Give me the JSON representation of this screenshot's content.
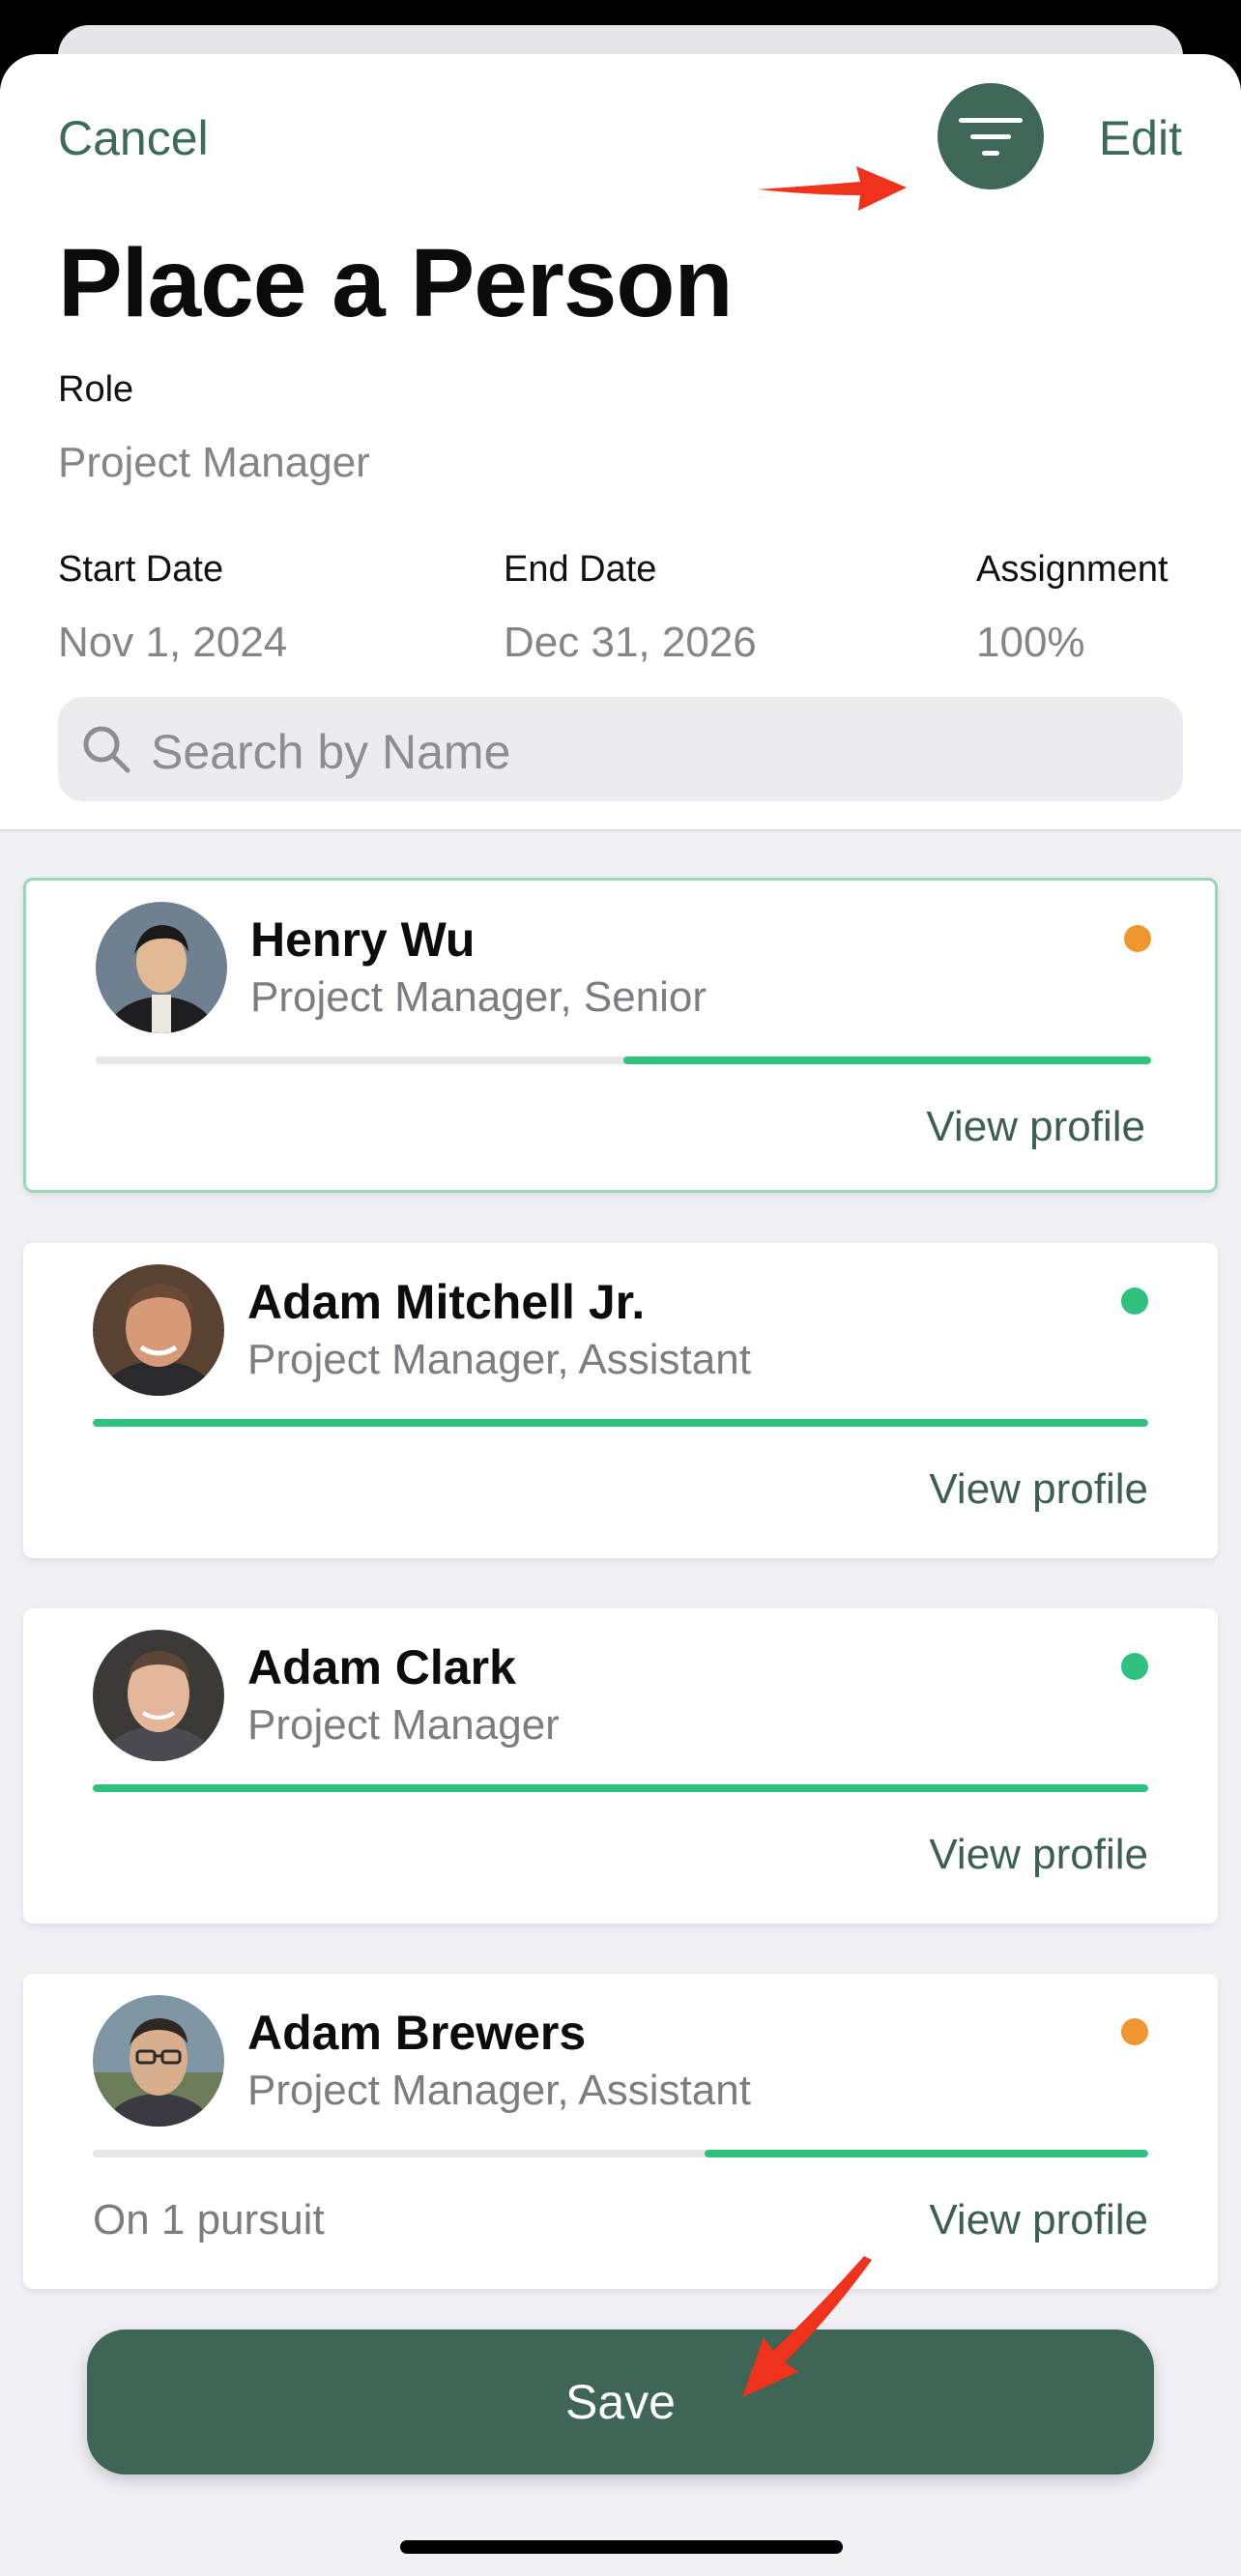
{
  "nav": {
    "cancel": "Cancel",
    "edit": "Edit",
    "filter_icon": "filter-icon"
  },
  "page": {
    "title": "Place a Person"
  },
  "role": {
    "label": "Role",
    "value": "Project Manager"
  },
  "dates": {
    "start_label": "Start Date",
    "start_value": "Nov 1, 2024",
    "end_label": "End Date",
    "end_value": "Dec 31, 2026",
    "assignment_label": "Assignment",
    "assignment_value": "100%"
  },
  "search": {
    "placeholder": "Search by Name",
    "icon": "search-icon"
  },
  "candidates": [
    {
      "name": "Henry Wu",
      "role": "Project Manager, Senior",
      "status_color": "#f0962e",
      "availability": 0.5,
      "selected": true,
      "view_label": "View profile",
      "note": ""
    },
    {
      "name": "Adam Mitchell Jr.",
      "role": "Project Manager, Assistant",
      "status_color": "#2ec27e",
      "availability": 1.0,
      "selected": false,
      "view_label": "View profile",
      "note": ""
    },
    {
      "name": "Adam Clark",
      "role": "Project Manager",
      "status_color": "#2ec27e",
      "availability": 1.0,
      "selected": false,
      "view_label": "View profile",
      "note": ""
    },
    {
      "name": "Adam Brewers",
      "role": "Project Manager, Assistant",
      "status_color": "#f0962e",
      "availability": 0.42,
      "selected": false,
      "view_label": "View profile",
      "note": "On 1 pursuit"
    }
  ],
  "footer": {
    "save": "Save"
  },
  "colors": {
    "accent": "#3f6557",
    "available": "#2ec27e",
    "partial": "#f0962e",
    "annotation_arrow": "#f0311c"
  }
}
